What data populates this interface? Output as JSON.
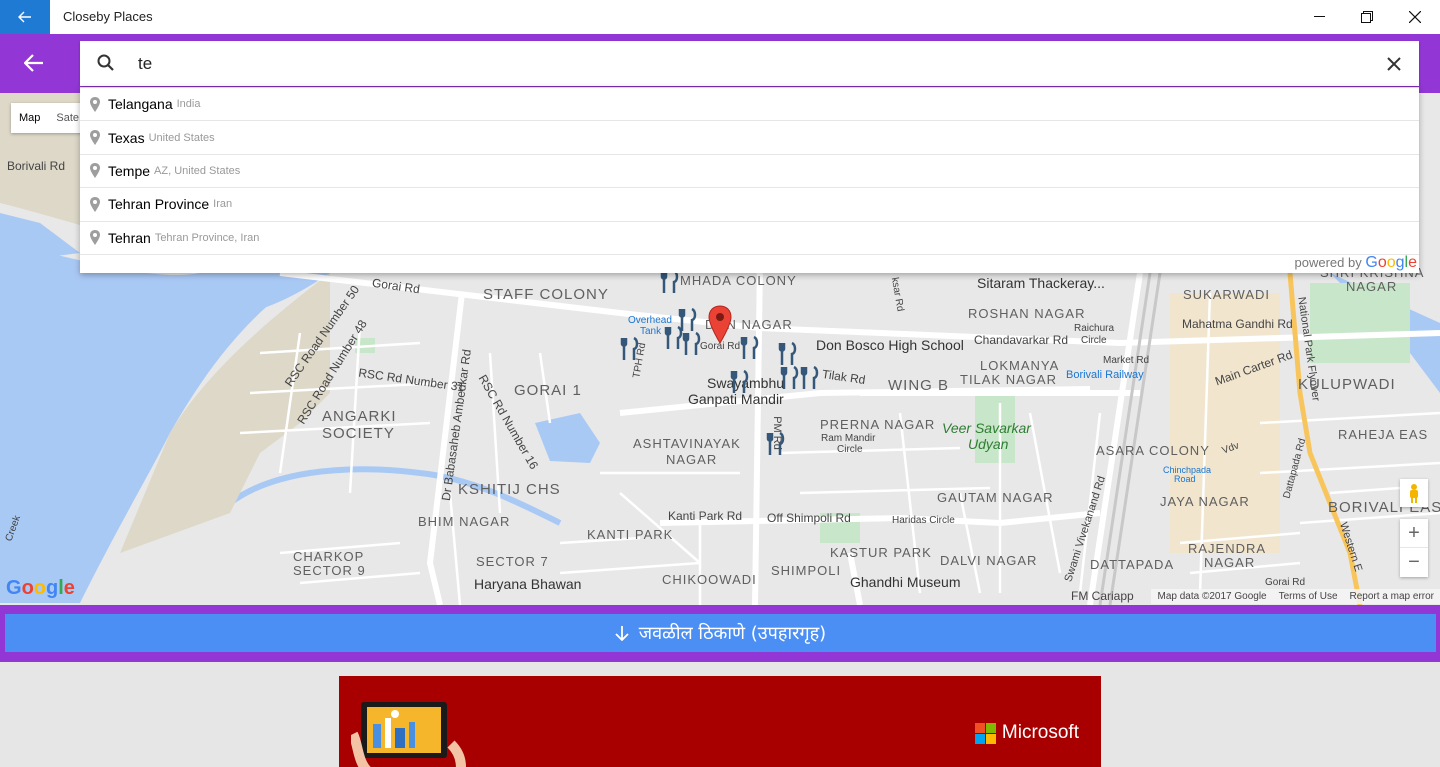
{
  "window": {
    "title": "Closeby Places"
  },
  "search": {
    "value": "te"
  },
  "suggestions": [
    {
      "main": "Telangana",
      "secondary": "India"
    },
    {
      "main": "Texas",
      "secondary": "United States"
    },
    {
      "main": "Tempe",
      "secondary": "AZ, United States"
    },
    {
      "main": "Tehran Province",
      "secondary": "Iran"
    },
    {
      "main": "Tehran",
      "secondary": "Tehran Province, Iran"
    }
  ],
  "powered_by": {
    "prefix": "powered by",
    "brand": "Google"
  },
  "map": {
    "type_control": {
      "map": "Map",
      "satellite": "Sate"
    },
    "labels": {
      "staff_colony": "STAFF COLONY",
      "mhada": "MHADA COLONY",
      "don_nagar": "DON NAGAR",
      "gorai1": "GORAI 1",
      "angarki": "ANGARKI",
      "society": "SOCIETY",
      "ashtavinayak": "ASHTAVINAYAK",
      "nagar1": "NAGAR",
      "kshitij": "KSHITIJ CHS",
      "bhim": "BHIM NAGAR",
      "kanti_park": "KANTI PARK",
      "sector7": "SECTOR 7",
      "charkop": "CHARKOP",
      "sector9": "SECTOR 9",
      "chikoowadi": "CHIKOOWADI",
      "shimpoli": "SHIMPOLI",
      "prerna": "PRERNA NAGAR",
      "wing": "WING B",
      "lokmanya": "LOKMANYA",
      "tilak": "TILAK NAGAR",
      "roshan": "ROSHAN NAGAR",
      "sukarwadi": "SUKARWADI",
      "shri_krishna": "SHRI KRISHNA",
      "nagar2": "NAGAR",
      "kulupwadi": "KULUPWADI",
      "raheja": "RAHEJA EAS",
      "asara": "ASARA COLONY",
      "jaya": "JAYA NAGAR",
      "gautam": "GAUTAM NAGAR",
      "kastur": "KASTUR PARK",
      "dalvi": "DALVI NAGAR",
      "rajendra": "RAJENDRA",
      "nagar3": "NAGAR",
      "dattapada": "DATTAPADA",
      "borivali_eas": "BORIVALI EAS",
      "don_bosco": "Don Bosco High School",
      "swayambhu": "Swayambhu",
      "ganpati": "Ganpati Mandir",
      "sitaram": "Sitaram Thackeray...",
      "haryana": "Haryana Bhawan",
      "ghandhi": "Ghandhi Museum",
      "veer": "Veer Savarkar",
      "udyan": "Udyan",
      "borivali_rd": "Borivali Rd",
      "gorai_rd": "Gorai Rd",
      "gorai_rd2": "Gorai Rd",
      "rsc50": "RSC Road Number 50",
      "rsc48": "RSC Road Number 48",
      "rsc31": "RSC Rd Number 31",
      "rsc16": "RSC Rd Number 16",
      "ambedkar": "Dr Babasaheb Ambedkar Rd",
      "kanti_rd": "Kanti Park Rd",
      "off_shimpoli": "Off Shimpoli Rd",
      "haridas": "Haridas Circle",
      "ram_mandir": "Ram Mandir",
      "circle": "Circle",
      "chandavarkar": "Chandavarkar Rd",
      "raichura": "Raichura",
      "raichura_circle": "Circle",
      "market": "Market Rd",
      "borivali_railway": "Borivali Railway",
      "mahatma": "Mahatma Gandhi Rd",
      "main_carter": "Main Carter Rd",
      "tilak_rd": "Tilak Rd",
      "overhead": "Overhead",
      "tank": "Tank",
      "chinchpada": "Chinchpada",
      "chinchpada2": "Road",
      "fm_cariappa": "FM Cariapp",
      "creek": "Creek",
      "tph": "TPH Rd",
      "pm_rd": "PM Rd",
      "ksar": "ksar Rd",
      "swami": "Swami Vivekanand Rd",
      "national_park": "National Park Flyover",
      "western": "Western E",
      "dattapada_rd": "Dattapada Rd",
      "gorai_rd3": "Gorai Rd",
      "vdv": "Vdv"
    },
    "attribution": [
      "Map data ©2017 Google",
      "Terms of Use",
      "Report a map error"
    ],
    "zoom": {
      "in": "+",
      "out": "−"
    },
    "google_logo": "Google"
  },
  "nearby_button": {
    "label": "जवळील ठिकाणे (उपहारगृह)"
  },
  "ad": {
    "brand": "Microsoft"
  },
  "colors": {
    "purple": "#9237d6",
    "blue_button": "#4b8ff5",
    "title_back": "#1e7ad3",
    "ad_red": "#a80000"
  }
}
